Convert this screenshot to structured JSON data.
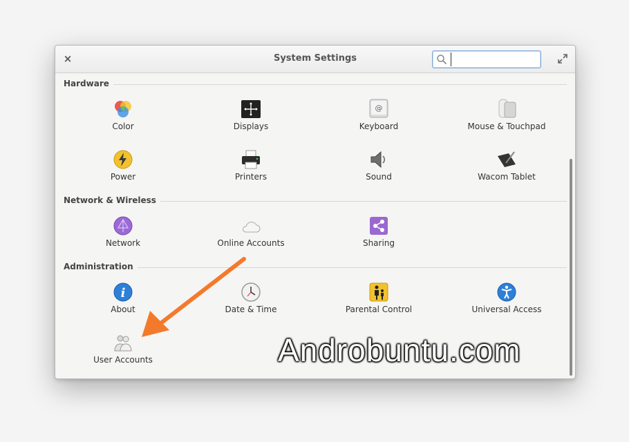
{
  "window": {
    "title": "System Settings",
    "close_label": "×",
    "search": {
      "placeholder": "",
      "value": ""
    }
  },
  "sections": [
    {
      "title": "Hardware"
    },
    {
      "title": "Network & Wireless"
    },
    {
      "title": "Administration"
    }
  ],
  "items": {
    "color": "Color",
    "displays": "Displays",
    "keyboard": "Keyboard",
    "mouse": "Mouse & Touchpad",
    "power": "Power",
    "printers": "Printers",
    "sound": "Sound",
    "wacom": "Wacom Tablet",
    "network": "Network",
    "online_accounts": "Online Accounts",
    "sharing": "Sharing",
    "about": "About",
    "date_time": "Date & Time",
    "parental": "Parental Control",
    "universal": "Universal Access",
    "user_accounts": "User Accounts"
  },
  "overlay": {
    "watermark": "Androbuntu.com",
    "arrow_color": "#f47a2b"
  }
}
